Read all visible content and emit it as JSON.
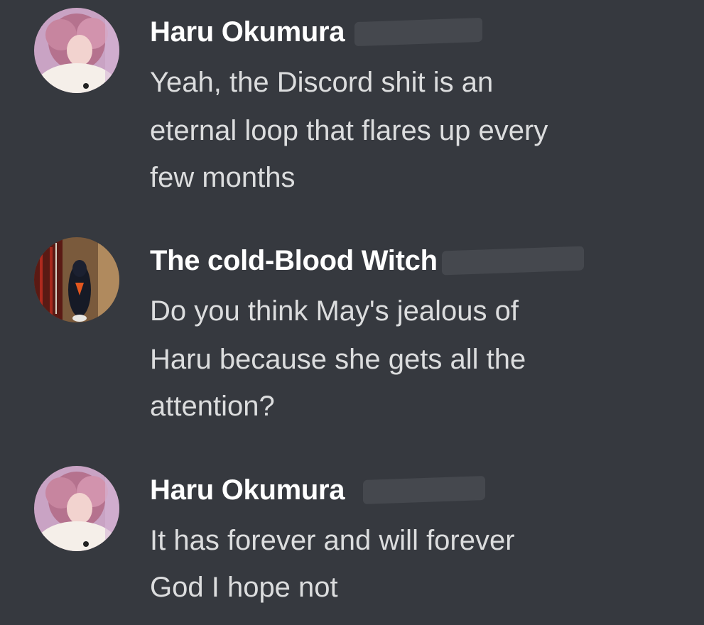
{
  "messages": [
    {
      "author": "Haru Okumura",
      "avatar": "haru-avatar",
      "lines": [
        "Yeah, the Discord shit is an",
        "eternal loop that flares up every",
        "few months"
      ]
    },
    {
      "author": "The cold-Blood Witch",
      "avatar": "witch-avatar",
      "lines": [
        "Do you think May's jealous of",
        "Haru because she gets all the",
        "attention?"
      ]
    },
    {
      "author": "Haru Okumura",
      "avatar": "haru-avatar",
      "lines": [
        "It has forever and will forever",
        "God I hope not"
      ]
    }
  ],
  "colors": {
    "background": "#36393f",
    "username": "#ffffff",
    "message_text": "#dcddde",
    "redaction": "#45484e"
  }
}
